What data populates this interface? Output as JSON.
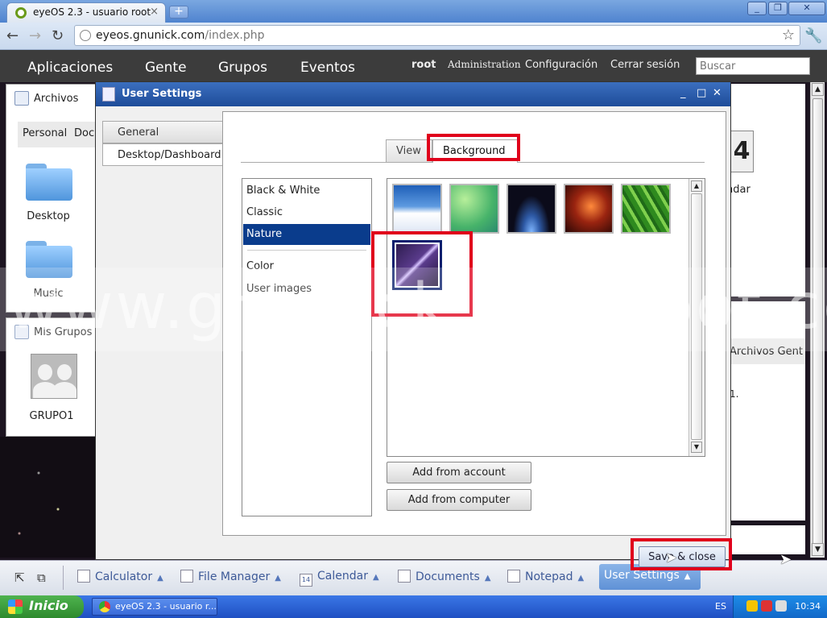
{
  "browser": {
    "tab_title": "eyeOS 2.3 - usuario root",
    "tab_close": "×",
    "new_tab": "+",
    "url_host": "eyeos.gnunick.com",
    "url_path": "/index.php",
    "minimize": "_",
    "restore": "❐",
    "close": "✕"
  },
  "appbar": {
    "menu": [
      "Aplicaciones",
      "Gente",
      "Grupos",
      "Eventos"
    ],
    "user": "root",
    "links": [
      "Administration",
      "Configuración",
      "Cerrar sesión"
    ],
    "search_placeholder": "Buscar"
  },
  "desktop": {
    "files_widget": {
      "title": "Archivos",
      "tabs": [
        "Personal",
        "Doc"
      ],
      "folders": [
        "Desktop",
        "Music"
      ]
    },
    "groups_widget": {
      "title": "Mis Grupos",
      "group": "GRUPO1"
    },
    "calendar_label": "ndar",
    "calendar_day": "4",
    "right_files_tabs": "Archivos  Gent",
    "right_files_number": "1."
  },
  "dialog": {
    "title": "User Settings",
    "side_tabs": [
      "General",
      "Desktop/Dashboard"
    ],
    "inner_tabs": [
      "View",
      "Background"
    ],
    "categories": [
      "Black & White",
      "Classic",
      "Nature",
      "Color",
      "User images"
    ],
    "selected_category": "Nature",
    "add_from_account": "Add from account",
    "add_from_computer": "Add from computer",
    "save_close": "Save & close",
    "thumbnails": [
      "clouds-thumbnail",
      "green-abstract-thumbnail",
      "earth-from-space-thumbnail",
      "red-nebula-thumbnail",
      "green-leaves-thumbnail",
      "lightning-thumbnail"
    ],
    "selected_thumbnail": "lightning-thumbnail"
  },
  "eyebar": {
    "tasks": [
      "Calculator",
      "File Manager",
      "Calendar",
      "Documents",
      "Notepad"
    ],
    "active_task": "User Settings",
    "calendar_icon_day": "14"
  },
  "winbar": {
    "start": "Inicio",
    "task": "eyeOS 2.3 - usuario r...",
    "lang": "ES",
    "clock": "10:34"
  },
  "watermark": "www.gnunick.blogspot.com",
  "colors": {
    "highlight": "#e0001b",
    "selection": "#0a3c8c",
    "titlebar": "#1e4c99"
  }
}
